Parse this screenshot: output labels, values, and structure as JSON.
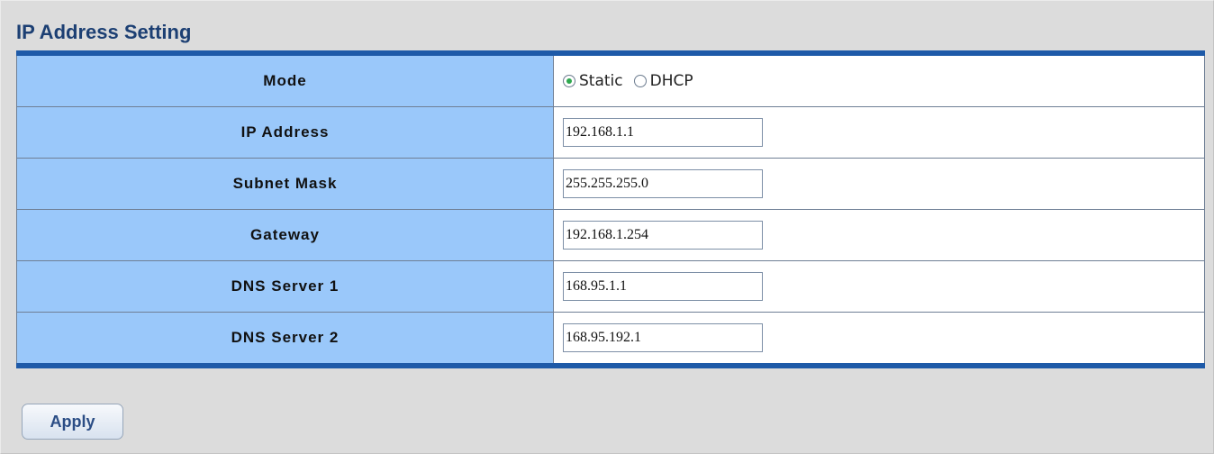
{
  "section": {
    "title": "IP Address Setting"
  },
  "mode": {
    "label": "Mode",
    "options": [
      {
        "label": "Static",
        "selected": true
      },
      {
        "label": "DHCP",
        "selected": false
      }
    ]
  },
  "fields": [
    {
      "label": "IP Address",
      "value": "192.168.1.1"
    },
    {
      "label": "Subnet Mask",
      "value": "255.255.255.0"
    },
    {
      "label": "Gateway",
      "value": "192.168.1.254"
    },
    {
      "label": "DNS Server 1",
      "value": "168.95.1.1"
    },
    {
      "label": "DNS Server 2",
      "value": "168.95.192.1"
    }
  ],
  "actions": {
    "apply_label": "Apply"
  },
  "colors": {
    "label_bg": "#9ac8fa",
    "border_accent": "#1e5aa8",
    "radio_selected": "#2fa84f"
  }
}
